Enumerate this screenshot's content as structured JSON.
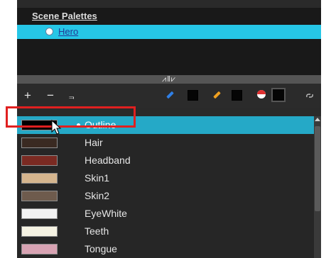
{
  "scene_palettes": {
    "header": "Scene Palettes",
    "items": [
      {
        "label": "Hero",
        "selected": true
      }
    ]
  },
  "splitter": {
    "handle_label": "⩘‖⩗"
  },
  "toolbar": {
    "add": "+",
    "remove": "−",
    "clone": "⫬",
    "colors": {
      "line_pencil": "#2f7fe6",
      "fill_pencil": "#f0a020",
      "brush": "#e03030"
    }
  },
  "palette": {
    "swatches": [
      {
        "name": "Outline",
        "color": "#000000",
        "selected": true
      },
      {
        "name": "Hair",
        "color": "#3a2a22",
        "selected": false
      },
      {
        "name": "Headband",
        "color": "#7a2a22",
        "selected": false
      },
      {
        "name": "Skin1",
        "color": "#d5b58e",
        "selected": false
      },
      {
        "name": "Skin2",
        "color": "#6e5b4d",
        "selected": false
      },
      {
        "name": "EyeWhite",
        "color": "#f2f2f2",
        "selected": false
      },
      {
        "name": "Teeth",
        "color": "#f5f2e2",
        "selected": false
      },
      {
        "name": "Tongue",
        "color": "#d8a3b3",
        "selected": false
      }
    ]
  },
  "annotation": {
    "color": "#e02020"
  }
}
